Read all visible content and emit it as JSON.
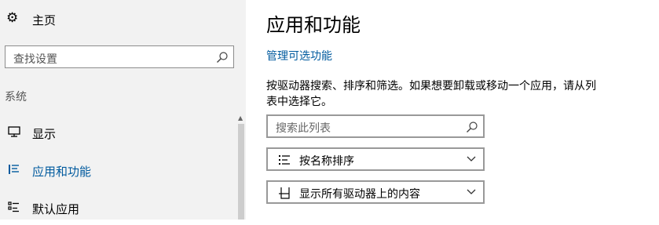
{
  "sidebar": {
    "home_label": "主页",
    "search_placeholder": "查找设置",
    "section_label": "系统",
    "items": [
      {
        "label": "显示",
        "icon": "monitor-icon"
      },
      {
        "label": "应用和功能",
        "icon": "list-icon",
        "active": true
      },
      {
        "label": "默认应用",
        "icon": "default-apps-icon"
      }
    ]
  },
  "main": {
    "title": "应用和功能",
    "manage_link": "管理可选功能",
    "description": "按驱动器搜索、排序和筛选。如果想要卸载或移动一个应用，请从列表中选择它。",
    "search_placeholder": "搜索此列表",
    "sort_label": "按名称排序",
    "filter_label": "显示所有驱动器上的内容"
  },
  "colors": {
    "accent": "#005a9e",
    "sidebar_bg": "#f2f2f2",
    "border": "#999999"
  }
}
